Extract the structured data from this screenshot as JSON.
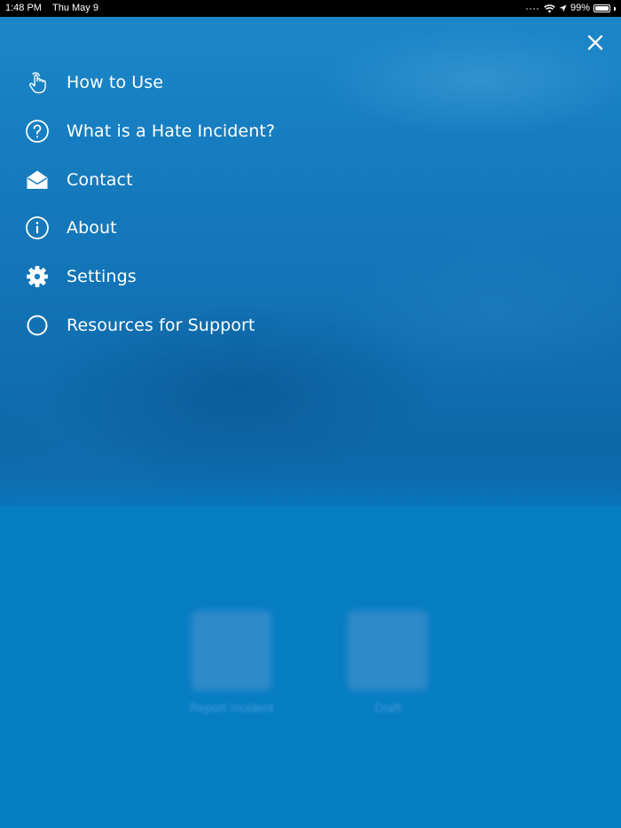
{
  "status_bar": {
    "time": "1:48 PM",
    "date": "Thu May 9",
    "battery_percent": "99%",
    "battery_level": 0.99,
    "icons": [
      "cellular-dots-icon",
      "wifi-icon",
      "location-arrow-icon",
      "battery-icon"
    ]
  },
  "close": {
    "icon": "close-icon"
  },
  "menu": {
    "items": [
      {
        "label": "How to Use",
        "icon": "touch-hand-icon"
      },
      {
        "label": "What is a Hate Incident?",
        "icon": "question-circle-icon"
      },
      {
        "label": "Contact",
        "icon": "envelope-open-icon"
      },
      {
        "label": "About",
        "icon": "info-circle-icon"
      },
      {
        "label": "Settings",
        "icon": "gear-icon"
      },
      {
        "label": "Resources for Support",
        "icon": "circle-icon"
      }
    ]
  },
  "background_home": {
    "buttons": [
      {
        "label": "Report Incident"
      },
      {
        "label": "Draft"
      }
    ]
  },
  "colors": {
    "accent": "#077dc4",
    "menu_background": "#1a86c8",
    "text": "#ffffff"
  }
}
